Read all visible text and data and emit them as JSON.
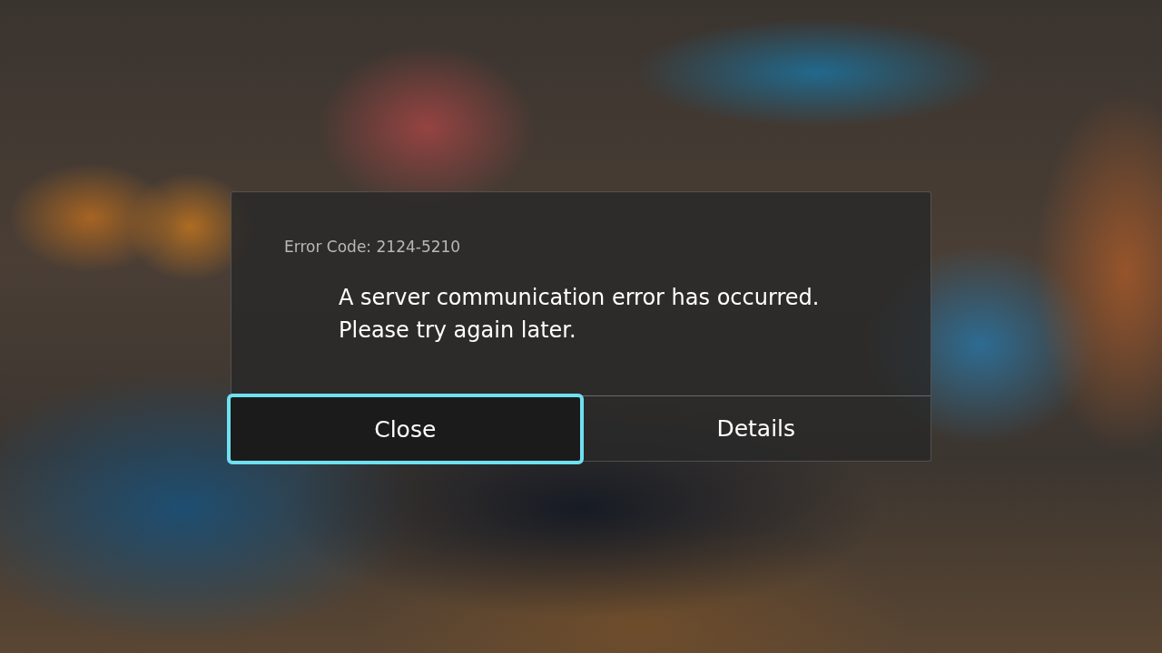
{
  "dialog": {
    "error_code": "Error Code: 2124-5210",
    "message_lines": [
      "A server communication error has occurred.",
      "Please try again later."
    ],
    "buttons": [
      {
        "label": "Close",
        "selected": true
      },
      {
        "label": "Details",
        "selected": false
      }
    ]
  }
}
